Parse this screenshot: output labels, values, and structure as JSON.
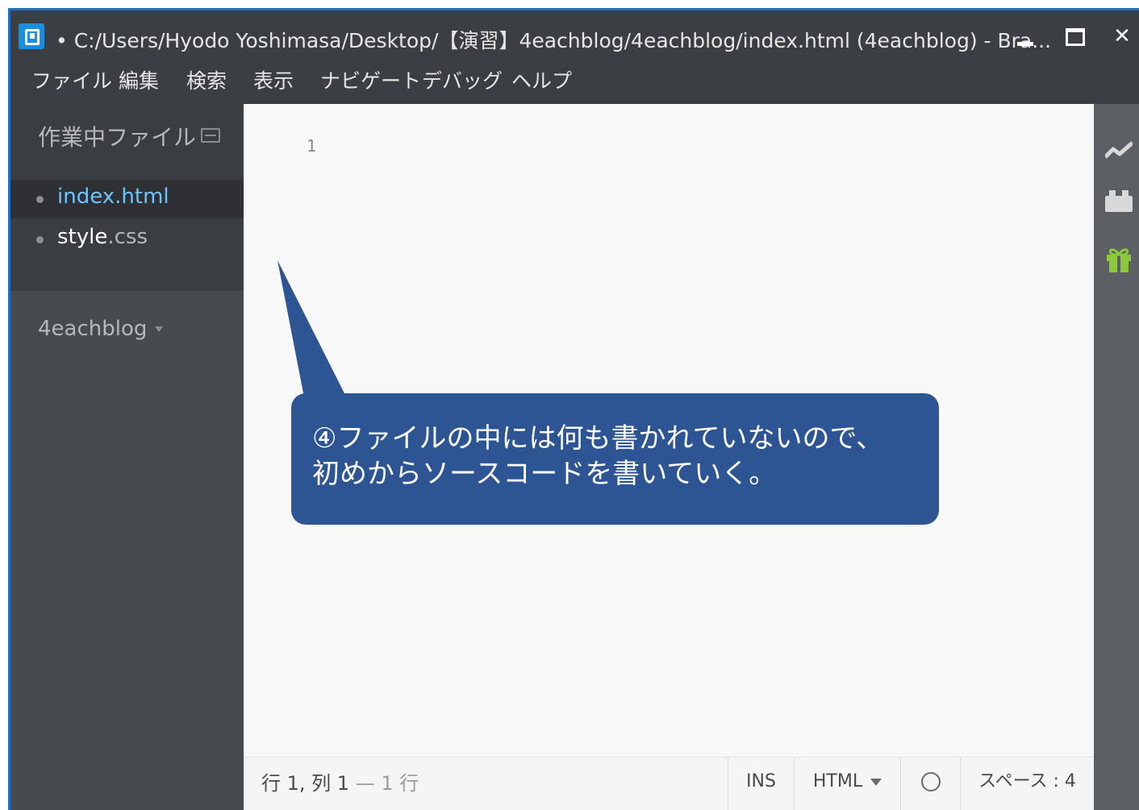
{
  "window": {
    "title": "• C:/Users/Hyodo Yoshimasa/Desktop/【演習】4eachblog/4eachblog/index.html (4eachblog) - Bra...",
    "minimize_label": "",
    "maximize_label": "",
    "close_label": "✕"
  },
  "menu": {
    "items": [
      "ファイル",
      "編集",
      "検索",
      "表示",
      "ナビゲート",
      "デバッグ",
      "ヘルプ"
    ]
  },
  "sidebar": {
    "working_files_title": "作業中ファイル",
    "files": [
      {
        "base": "index",
        "ext": ".html",
        "selected": true
      },
      {
        "base": "style",
        "ext": ".css",
        "selected": false
      }
    ],
    "project_name": "4eachblog"
  },
  "editor": {
    "line_numbers": [
      "1"
    ]
  },
  "statusbar": {
    "cursor_position": "行 1, 列 1",
    "line_count": "— 1 行",
    "insert_mode": "INS",
    "language": "HTML",
    "indent": "スペース : 4"
  },
  "toolbar": {
    "icons": [
      "live-preview-icon",
      "extension-manager-icon",
      "gift-icon"
    ]
  },
  "callout": {
    "line1": "④ファイルの中には何も書かれていないので、",
    "line2": "初めからソースコードを書いていく。"
  },
  "colors": {
    "accent_selected_file": "#6ec4ff",
    "callout_bg": "#2e5593",
    "window_border": "#1d6fc8",
    "gift_icon": "#8cc83c"
  }
}
